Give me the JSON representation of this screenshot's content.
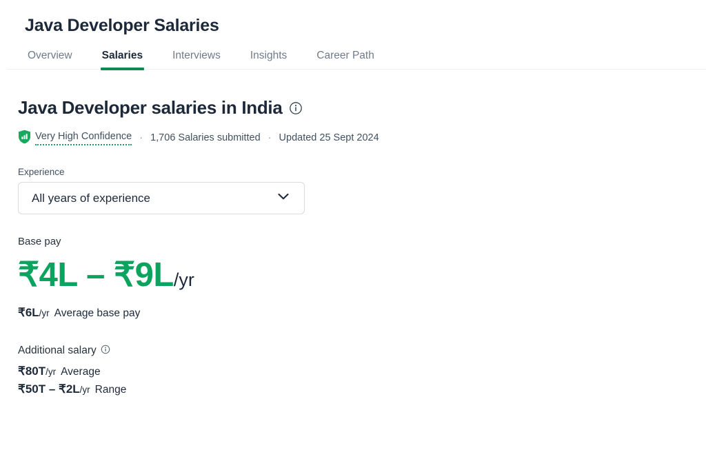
{
  "header": {
    "title": "Java Developer Salaries"
  },
  "tabs": {
    "items": [
      {
        "label": "Overview",
        "active": false
      },
      {
        "label": "Salaries",
        "active": true
      },
      {
        "label": "Interviews",
        "active": false
      },
      {
        "label": "Insights",
        "active": false
      },
      {
        "label": "Career Path",
        "active": false
      }
    ]
  },
  "main": {
    "section_title": "Java Developer salaries in India",
    "title_info_icon": "info-icon",
    "meta": {
      "confidence_icon": "shield-bar-chart-icon",
      "confidence_label": "Very High Confidence",
      "separator": "·",
      "salaries_submitted": "1,706 Salaries submitted",
      "updated": "Updated 25 Sept 2024"
    },
    "experience_filter": {
      "label": "Experience",
      "value": "All years of experience",
      "chevron_icon": "chevron-down-icon",
      "options": [
        "All years of experience"
      ]
    },
    "base_pay": {
      "label": "Base pay",
      "range_low": "₹4L",
      "range_dash": " – ",
      "range_high": "₹9L",
      "per_unit": "/yr",
      "average_amount": "₹6L",
      "average_per_unit": "/yr",
      "average_caption": "Average base pay"
    },
    "additional_salary": {
      "label": "Additional salary",
      "info_icon": "info-icon",
      "average_amount": "₹80T",
      "average_per_unit": "/yr",
      "average_caption": "Average",
      "range_low": "₹50T",
      "range_dash": " – ",
      "range_high": "₹2L",
      "range_per_unit": "/yr",
      "range_caption": "Range"
    }
  },
  "colors": {
    "brand_green": "#0ca35e",
    "tab_underline_green": "#0c8a52",
    "confidence_green": "#17a05e",
    "text_primary": "#1d2939",
    "text_secondary": "#41505f",
    "text_muted": "#6f7b8a",
    "border": "#d7dce1",
    "divider": "#f0f1f3"
  }
}
